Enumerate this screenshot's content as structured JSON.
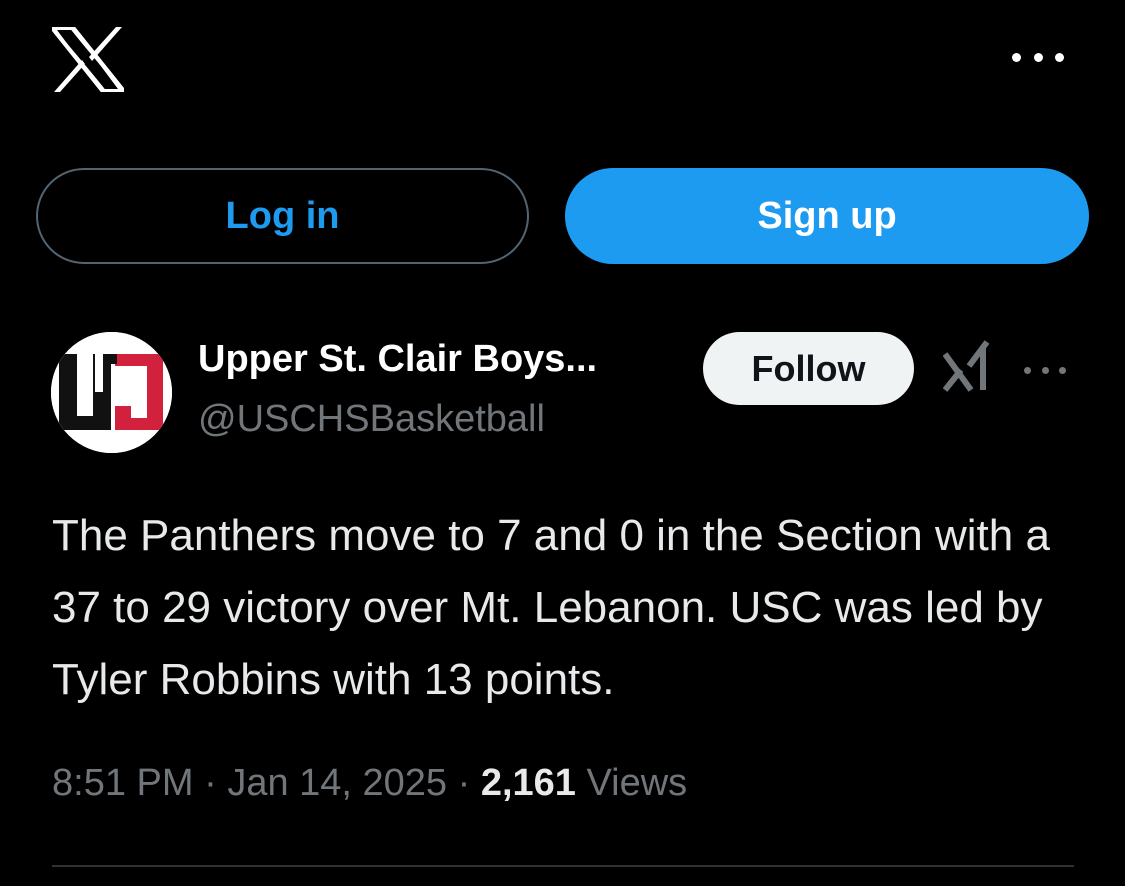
{
  "header": {
    "logo_icon": "x-logo-icon",
    "more_icon": "more-horizontal-icon"
  },
  "auth": {
    "login_label": "Log in",
    "signup_label": "Sign up"
  },
  "post": {
    "author": {
      "display_name": "Upper St. Clair Boys...",
      "handle": "@USCHSBasketball",
      "avatar_icon": "team-logo-avatar"
    },
    "follow_label": "Follow",
    "grok_icon": "grok-icon",
    "more_icon": "more-horizontal-icon",
    "text": "The Panthers move to 7 and 0 in the Section with a 37 to 29 victory over Mt. Lebanon. USC was led by Tyler Robbins with 13 points.",
    "time": "8:51 PM",
    "separator": "·",
    "date": "Jan 14, 2025",
    "views_count": "2,161",
    "views_label": "Views"
  },
  "colors": {
    "background": "#000000",
    "accent": "#1d9bf0",
    "text_primary": "#e7e9ea",
    "text_secondary": "#71767b",
    "border": "#536471",
    "follow_bg": "#eff3f4"
  }
}
